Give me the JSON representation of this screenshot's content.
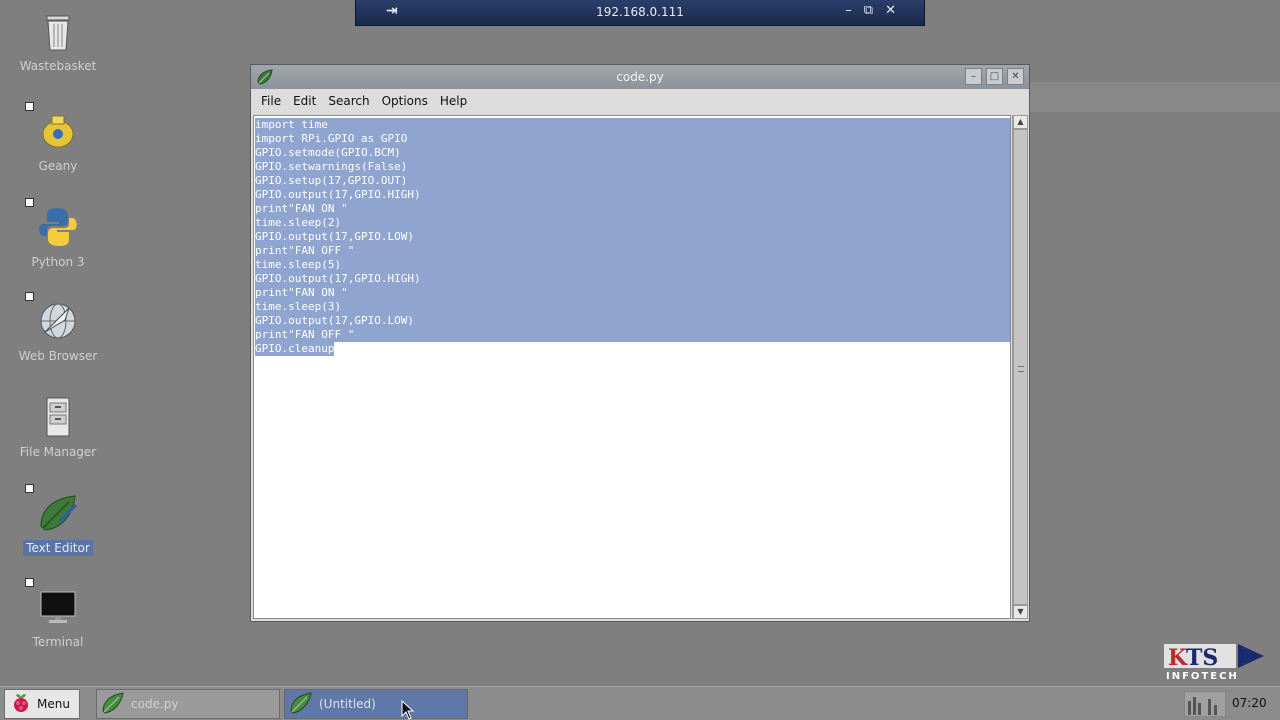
{
  "remote_bar": {
    "host": "192.168.0.111"
  },
  "desktop_icons": [
    {
      "label": "Wastebasket"
    },
    {
      "label": "Geany"
    },
    {
      "label": "Python 3"
    },
    {
      "label": "Web Browser"
    },
    {
      "label": "File Manager"
    },
    {
      "label": "Text Editor",
      "selected": true
    },
    {
      "label": "Terminal"
    }
  ],
  "window": {
    "title": "code.py",
    "menu": [
      "File",
      "Edit",
      "Search",
      "Options",
      "Help"
    ],
    "code_lines": [
      "import time",
      "import RPi.GPIO as GPIO",
      "GPIO.setmode(GPIO.BCM)",
      "GPIO.setwarnings(False)",
      "GPIO.setup(17,GPIO.OUT)",
      "GPIO.output(17,GPIO.HIGH)",
      "print\"FAN ON \"",
      "time.sleep(2)",
      "GPIO.output(17,GPIO.LOW)",
      "print\"FAN OFF \"",
      "time.sleep(5)",
      "GPIO.output(17,GPIO.HIGH)",
      "print\"FAN ON \"",
      "time.sleep(3)",
      "GPIO.output(17,GPIO.LOW)",
      "print\"FAN OFF \"",
      "GPIO.cleanup"
    ]
  },
  "taskbar": {
    "menu_label": "Menu",
    "tasks": [
      {
        "label": "code.py",
        "active": false
      },
      {
        "label": "(Untitled)",
        "active": true
      }
    ],
    "clock": "07:20"
  },
  "logo": {
    "line1": "KTS",
    "line2": "INFOTECH"
  },
  "colors": {
    "desktop": "#7f7f7f",
    "selection": "#8fa5cf",
    "titlebar": "#969da4",
    "task_active": "#5f78a8"
  }
}
